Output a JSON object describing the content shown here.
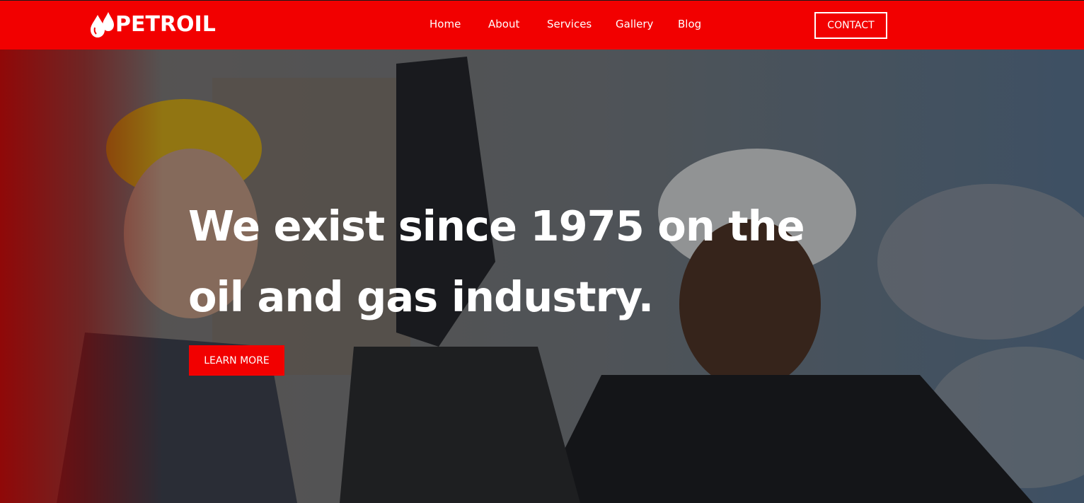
{
  "brand": {
    "name": "PETROIL",
    "logo_icon": "oil-drop-icon",
    "color": "#f20000"
  },
  "nav": {
    "items": [
      {
        "label": "Home"
      },
      {
        "label": "About"
      },
      {
        "label": "Services"
      },
      {
        "label": "Gallery"
      },
      {
        "label": "Blog"
      }
    ],
    "contact_label": "CONTACT"
  },
  "hero": {
    "headline_line1": "We exist since 1975 on the",
    "headline_line2": "oil and gas industry.",
    "cta_label": "LEARN MORE"
  }
}
